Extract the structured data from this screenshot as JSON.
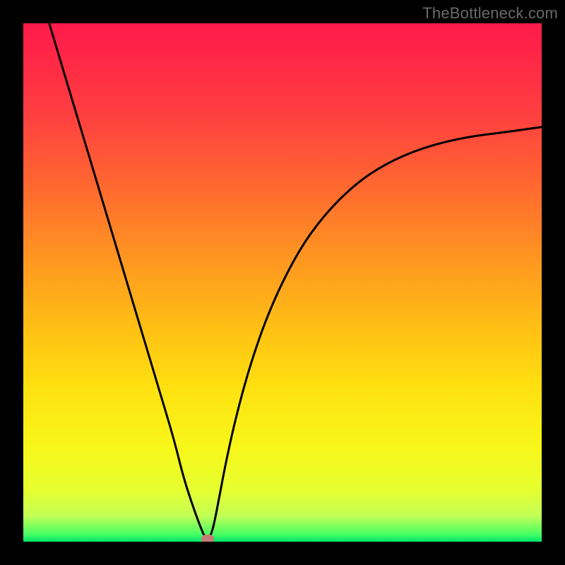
{
  "watermark": "TheBottleneck.com",
  "chart_data": {
    "type": "line",
    "title": "",
    "xlabel": "",
    "ylabel": "",
    "xlim": [
      0,
      1
    ],
    "ylim": [
      0,
      1
    ],
    "legend": false,
    "grid": false,
    "background": "gradient_red_to_green_vertical",
    "series": [
      {
        "name": "bottleneck-curve",
        "color": "#000000",
        "x": [
          0.05,
          0.08,
          0.11,
          0.14,
          0.17,
          0.2,
          0.23,
          0.26,
          0.29,
          0.31,
          0.33,
          0.345,
          0.355,
          0.365,
          0.375,
          0.39,
          0.41,
          0.44,
          0.48,
          0.53,
          0.58,
          0.64,
          0.7,
          0.77,
          0.85,
          0.93,
          1.0
        ],
        "y": [
          1.0,
          0.9,
          0.8,
          0.7,
          0.6,
          0.5,
          0.4,
          0.3,
          0.2,
          0.12,
          0.06,
          0.02,
          0.0,
          0.02,
          0.07,
          0.15,
          0.24,
          0.35,
          0.46,
          0.56,
          0.63,
          0.69,
          0.73,
          0.76,
          0.78,
          0.79,
          0.8
        ]
      }
    ],
    "annotations": [
      {
        "name": "optimal-marker",
        "x": 0.355,
        "y": 0.0,
        "shape": "rounded-rect",
        "color": "#c77a7a"
      }
    ],
    "gradient_stops": [
      {
        "pos": 0.0,
        "color": "#ff1a4b"
      },
      {
        "pos": 0.32,
        "color": "#ff6a2f"
      },
      {
        "pos": 0.58,
        "color": "#ffbd15"
      },
      {
        "pos": 0.82,
        "color": "#f7f71a"
      },
      {
        "pos": 0.95,
        "color": "#c3ff55"
      },
      {
        "pos": 1.0,
        "color": "#00e46a"
      }
    ]
  }
}
